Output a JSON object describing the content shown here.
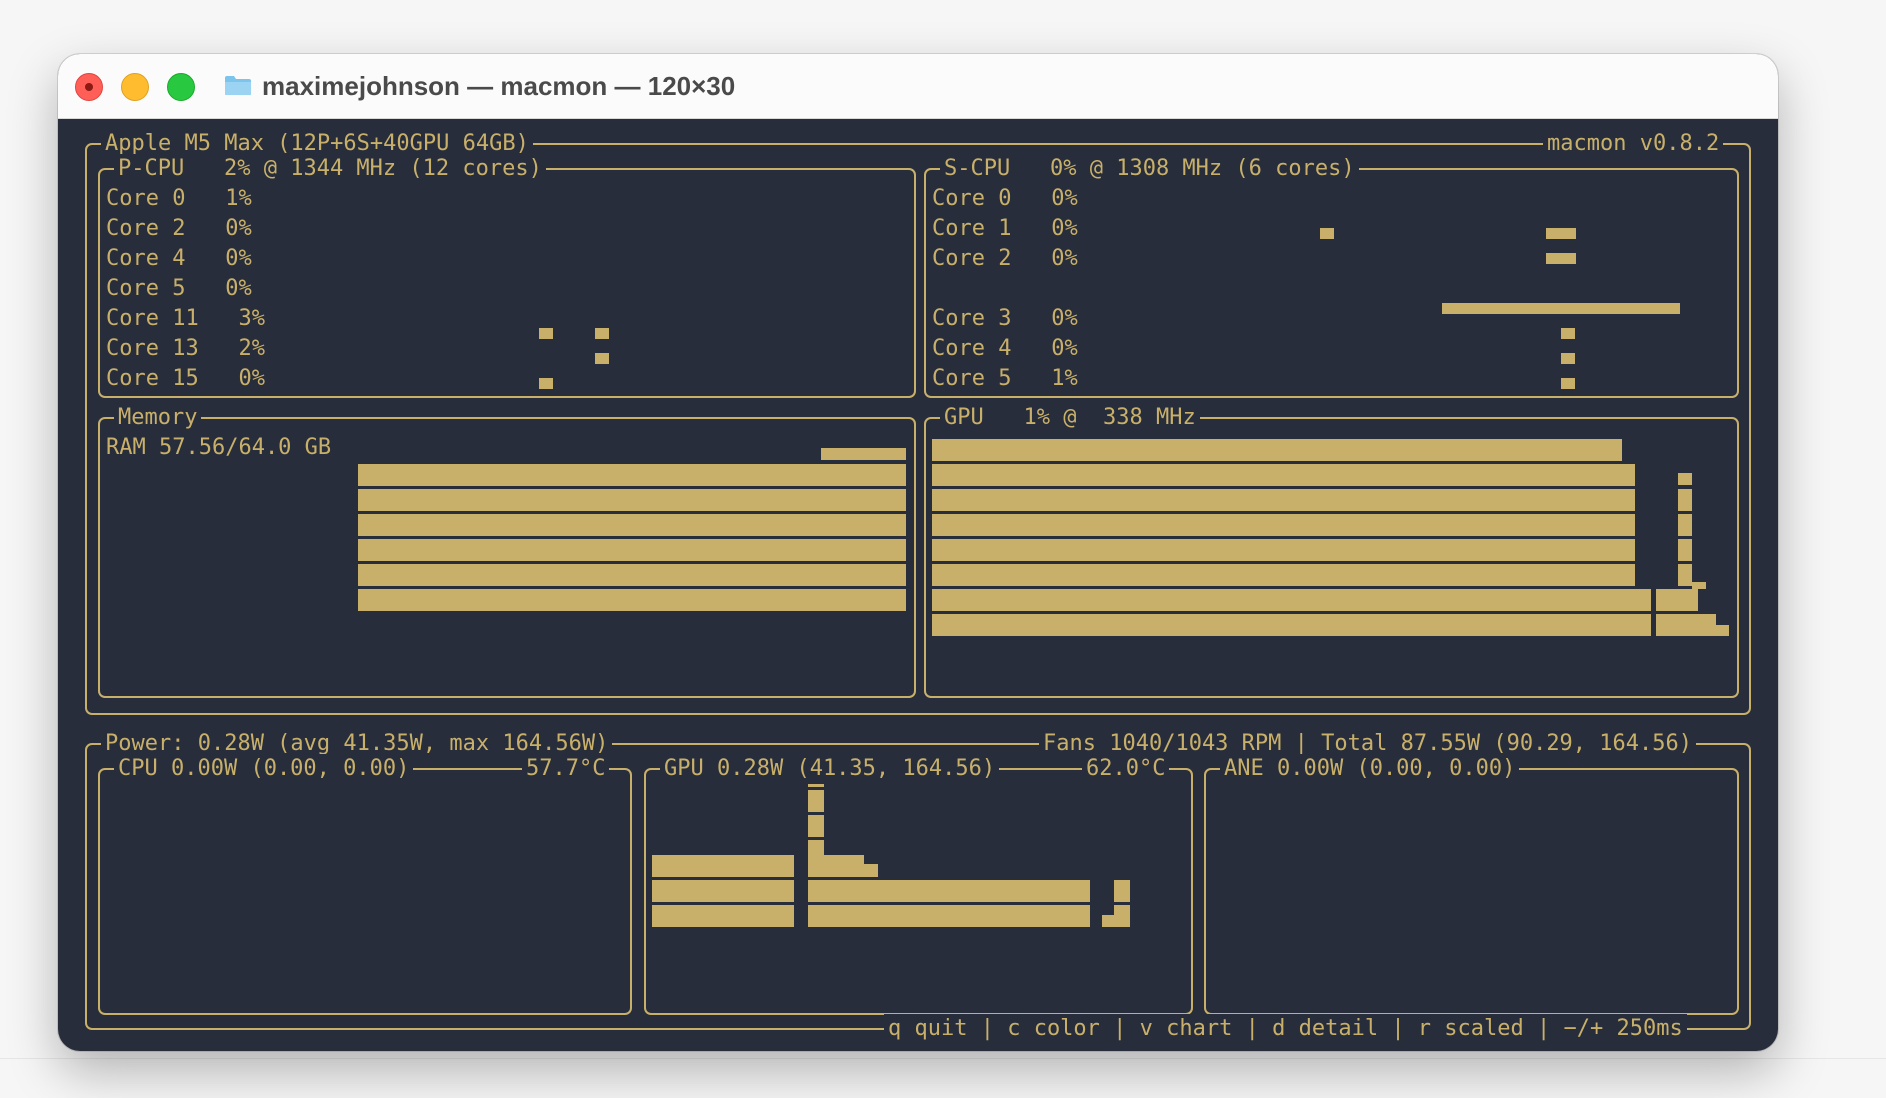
{
  "window": {
    "title": "maximejohnson — macmon — 120×30",
    "icon": "folder-icon",
    "colors": {
      "background": "#272d3b",
      "accent": "#c9b06a"
    }
  },
  "header": {
    "chip": "Apple M5 Max (12P+6S+40GPU 64GB)",
    "version": "macmon v0.8.2"
  },
  "pcpu": {
    "label": "P-CPU",
    "summary": "2% @ 1344 MHz (12 cores)",
    "cores": [
      {
        "name": "Core 0",
        "usage": "1%"
      },
      {
        "name": "Core 2",
        "usage": "0%"
      },
      {
        "name": "Core 4",
        "usage": "0%"
      },
      {
        "name": "Core 5",
        "usage": "0%"
      },
      {
        "name": "Core 11",
        "usage": "3%"
      },
      {
        "name": "Core 13",
        "usage": "2%"
      },
      {
        "name": "Core 15",
        "usage": "0%"
      }
    ]
  },
  "scpu": {
    "label": "S-CPU",
    "summary": "0% @ 1308 MHz (6 cores)",
    "cores": [
      {
        "name": "Core 0",
        "usage": "0%"
      },
      {
        "name": "Core 1",
        "usage": "0%"
      },
      {
        "name": "Core 2",
        "usage": "0%"
      },
      {
        "name": "Core 3",
        "usage": "0%"
      },
      {
        "name": "Core 4",
        "usage": "0%"
      },
      {
        "name": "Core 5",
        "usage": "1%"
      }
    ]
  },
  "memory": {
    "label": "Memory",
    "ram": "RAM 57.56/64.0 GB",
    "usage_fraction": 0.899
  },
  "gpu": {
    "label": "GPU",
    "summary": "1% @  338 MHz"
  },
  "power": {
    "summary": "Power: 0.28W (avg 41.35W, max 164.56W)",
    "fans_total": "Fans 1040/1043 RPM | Total 87.55W (90.29, 164.56)",
    "cpu": {
      "label": "CPU 0.00W (0.00, 0.00)",
      "temp": "57.7°C"
    },
    "gpu": {
      "label": "GPU 0.28W (41.35, 164.56)",
      "temp": "62.0°C"
    },
    "ane": {
      "label": "ANE 0.00W (0.00, 0.00)"
    }
  },
  "footer": {
    "keys": "q quit | c color | v chart | d detail | r scaled | −/+ 250ms"
  }
}
